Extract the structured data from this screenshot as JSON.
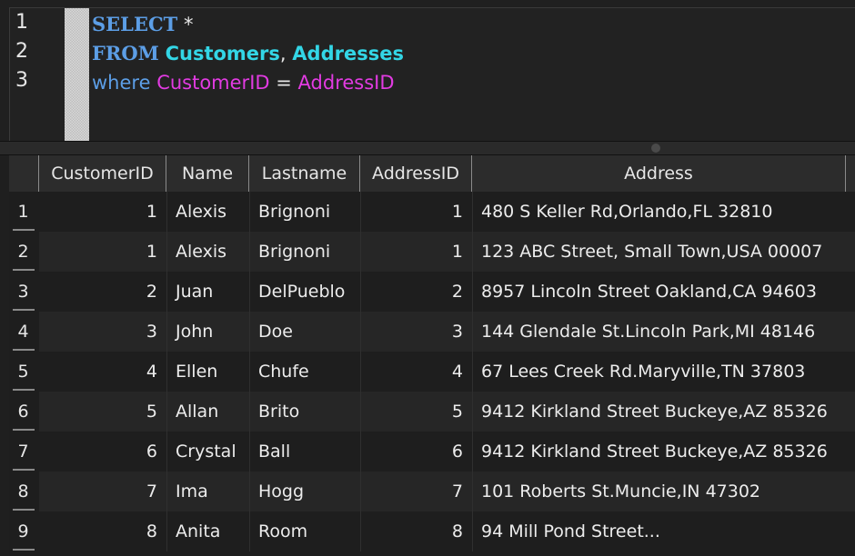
{
  "editor": {
    "line_numbers": [
      "1",
      "2",
      "3"
    ],
    "line1": {
      "keyword": "SELECT",
      "rest": " *"
    },
    "line2": {
      "keyword": "FROM",
      "table1": "Customers",
      "sep": ",",
      "table2": "Addresses"
    },
    "line3": {
      "keyword": "where",
      "left": "CustomerID",
      "op": "=",
      "right": "AddressID"
    }
  },
  "grid": {
    "headers": [
      "CustomerID",
      "Name",
      "Lastname",
      "AddressID",
      "Address"
    ],
    "row_numbers": [
      "1",
      "2",
      "3",
      "4",
      "5",
      "6",
      "7",
      "8",
      "9"
    ],
    "rows": [
      [
        "1",
        "Alexis",
        "Brignoni",
        "1",
        "480 S Keller Rd,Orlando,FL 32810"
      ],
      [
        "1",
        "Alexis",
        "Brignoni",
        "1",
        "123 ABC Street, Small Town,USA 00007"
      ],
      [
        "2",
        "Juan",
        "DelPueblo",
        "2",
        "8957 Lincoln Street Oakland,CA 94603"
      ],
      [
        "3",
        "John",
        "Doe",
        "3",
        "144 Glendale St.Lincoln Park,MI 48146"
      ],
      [
        "4",
        "Ellen",
        "Chufe",
        "4",
        "67 Lees Creek Rd.Maryville,TN 37803"
      ],
      [
        "5",
        "Allan",
        "Brito",
        "5",
        "9412 Kirkland Street Buckeye,AZ 85326"
      ],
      [
        "6",
        "Crystal",
        "Ball",
        "6",
        "9412 Kirkland Street Buckeye,AZ 85326"
      ],
      [
        "7",
        "Ima",
        "Hogg",
        "7",
        "101 Roberts St.Muncie,IN 47302"
      ],
      [
        "8",
        "Anita",
        "Room",
        "8",
        "94 Mill Pond Street..."
      ]
    ]
  },
  "colors": {
    "keyword": "#5c9ee6",
    "table": "#33d6e6",
    "column": "#e23be2",
    "background": "#1e1e1e"
  }
}
